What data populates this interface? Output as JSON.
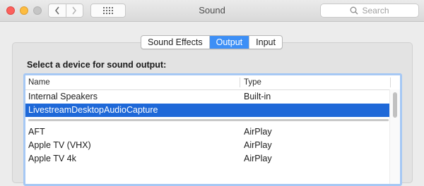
{
  "window": {
    "title": "Sound"
  },
  "toolbar": {
    "back_icon": "chevron-left-icon",
    "forward_icon": "chevron-right-icon",
    "grid_icon": "show-all-grid-icon",
    "search_placeholder": "Search"
  },
  "tabs": [
    {
      "label": "Sound Effects",
      "active": false
    },
    {
      "label": "Output",
      "active": true
    },
    {
      "label": "Input",
      "active": false
    }
  ],
  "output": {
    "heading": "Select a device for sound output:",
    "columns": {
      "name": "Name",
      "type": "Type"
    },
    "devices": [
      {
        "name": "Internal Speakers",
        "type": "Built-in",
        "selected": false
      },
      {
        "name": "LivestreamDesktopAudioCapture",
        "type": "",
        "selected": true
      },
      {
        "name": "AFT",
        "type": "AirPlay",
        "selected": false
      },
      {
        "name": "Apple TV (VHX)",
        "type": "AirPlay",
        "selected": false
      },
      {
        "name": "Apple TV 4k",
        "type": "AirPlay",
        "selected": false
      }
    ]
  },
  "colors": {
    "accent": "#3d8ff6",
    "selection": "#1e68d8",
    "focus_ring": "#a6c8f4"
  }
}
